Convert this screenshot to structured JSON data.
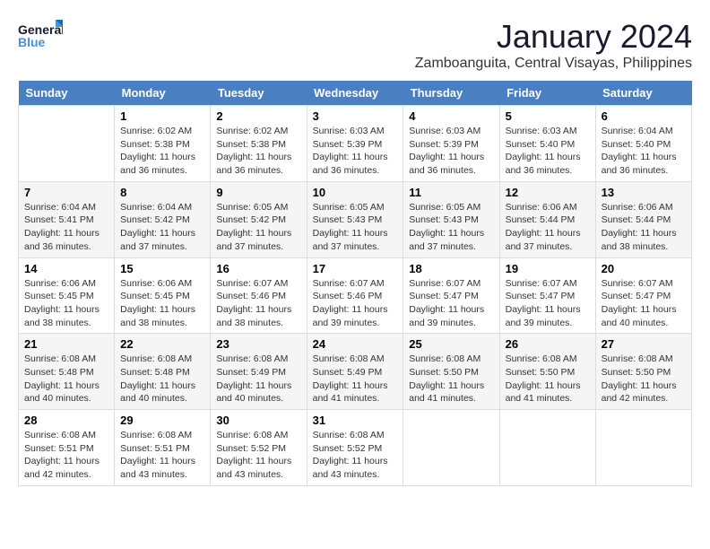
{
  "logo": {
    "general": "General",
    "blue": "Blue"
  },
  "title": {
    "month_year": "January 2024",
    "location": "Zamboanguita, Central Visayas, Philippines"
  },
  "headers": [
    "Sunday",
    "Monday",
    "Tuesday",
    "Wednesday",
    "Thursday",
    "Friday",
    "Saturday"
  ],
  "weeks": [
    [
      {
        "day": "",
        "sunrise": "",
        "sunset": "",
        "daylight": ""
      },
      {
        "day": "1",
        "sunrise": "Sunrise: 6:02 AM",
        "sunset": "Sunset: 5:38 PM",
        "daylight": "Daylight: 11 hours and 36 minutes."
      },
      {
        "day": "2",
        "sunrise": "Sunrise: 6:02 AM",
        "sunset": "Sunset: 5:38 PM",
        "daylight": "Daylight: 11 hours and 36 minutes."
      },
      {
        "day": "3",
        "sunrise": "Sunrise: 6:03 AM",
        "sunset": "Sunset: 5:39 PM",
        "daylight": "Daylight: 11 hours and 36 minutes."
      },
      {
        "day": "4",
        "sunrise": "Sunrise: 6:03 AM",
        "sunset": "Sunset: 5:39 PM",
        "daylight": "Daylight: 11 hours and 36 minutes."
      },
      {
        "day": "5",
        "sunrise": "Sunrise: 6:03 AM",
        "sunset": "Sunset: 5:40 PM",
        "daylight": "Daylight: 11 hours and 36 minutes."
      },
      {
        "day": "6",
        "sunrise": "Sunrise: 6:04 AM",
        "sunset": "Sunset: 5:40 PM",
        "daylight": "Daylight: 11 hours and 36 minutes."
      }
    ],
    [
      {
        "day": "7",
        "sunrise": "Sunrise: 6:04 AM",
        "sunset": "Sunset: 5:41 PM",
        "daylight": "Daylight: 11 hours and 36 minutes."
      },
      {
        "day": "8",
        "sunrise": "Sunrise: 6:04 AM",
        "sunset": "Sunset: 5:42 PM",
        "daylight": "Daylight: 11 hours and 37 minutes."
      },
      {
        "day": "9",
        "sunrise": "Sunrise: 6:05 AM",
        "sunset": "Sunset: 5:42 PM",
        "daylight": "Daylight: 11 hours and 37 minutes."
      },
      {
        "day": "10",
        "sunrise": "Sunrise: 6:05 AM",
        "sunset": "Sunset: 5:43 PM",
        "daylight": "Daylight: 11 hours and 37 minutes."
      },
      {
        "day": "11",
        "sunrise": "Sunrise: 6:05 AM",
        "sunset": "Sunset: 5:43 PM",
        "daylight": "Daylight: 11 hours and 37 minutes."
      },
      {
        "day": "12",
        "sunrise": "Sunrise: 6:06 AM",
        "sunset": "Sunset: 5:44 PM",
        "daylight": "Daylight: 11 hours and 37 minutes."
      },
      {
        "day": "13",
        "sunrise": "Sunrise: 6:06 AM",
        "sunset": "Sunset: 5:44 PM",
        "daylight": "Daylight: 11 hours and 38 minutes."
      }
    ],
    [
      {
        "day": "14",
        "sunrise": "Sunrise: 6:06 AM",
        "sunset": "Sunset: 5:45 PM",
        "daylight": "Daylight: 11 hours and 38 minutes."
      },
      {
        "day": "15",
        "sunrise": "Sunrise: 6:06 AM",
        "sunset": "Sunset: 5:45 PM",
        "daylight": "Daylight: 11 hours and 38 minutes."
      },
      {
        "day": "16",
        "sunrise": "Sunrise: 6:07 AM",
        "sunset": "Sunset: 5:46 PM",
        "daylight": "Daylight: 11 hours and 38 minutes."
      },
      {
        "day": "17",
        "sunrise": "Sunrise: 6:07 AM",
        "sunset": "Sunset: 5:46 PM",
        "daylight": "Daylight: 11 hours and 39 minutes."
      },
      {
        "day": "18",
        "sunrise": "Sunrise: 6:07 AM",
        "sunset": "Sunset: 5:47 PM",
        "daylight": "Daylight: 11 hours and 39 minutes."
      },
      {
        "day": "19",
        "sunrise": "Sunrise: 6:07 AM",
        "sunset": "Sunset: 5:47 PM",
        "daylight": "Daylight: 11 hours and 39 minutes."
      },
      {
        "day": "20",
        "sunrise": "Sunrise: 6:07 AM",
        "sunset": "Sunset: 5:47 PM",
        "daylight": "Daylight: 11 hours and 40 minutes."
      }
    ],
    [
      {
        "day": "21",
        "sunrise": "Sunrise: 6:08 AM",
        "sunset": "Sunset: 5:48 PM",
        "daylight": "Daylight: 11 hours and 40 minutes."
      },
      {
        "day": "22",
        "sunrise": "Sunrise: 6:08 AM",
        "sunset": "Sunset: 5:48 PM",
        "daylight": "Daylight: 11 hours and 40 minutes."
      },
      {
        "day": "23",
        "sunrise": "Sunrise: 6:08 AM",
        "sunset": "Sunset: 5:49 PM",
        "daylight": "Daylight: 11 hours and 40 minutes."
      },
      {
        "day": "24",
        "sunrise": "Sunrise: 6:08 AM",
        "sunset": "Sunset: 5:49 PM",
        "daylight": "Daylight: 11 hours and 41 minutes."
      },
      {
        "day": "25",
        "sunrise": "Sunrise: 6:08 AM",
        "sunset": "Sunset: 5:50 PM",
        "daylight": "Daylight: 11 hours and 41 minutes."
      },
      {
        "day": "26",
        "sunrise": "Sunrise: 6:08 AM",
        "sunset": "Sunset: 5:50 PM",
        "daylight": "Daylight: 11 hours and 41 minutes."
      },
      {
        "day": "27",
        "sunrise": "Sunrise: 6:08 AM",
        "sunset": "Sunset: 5:50 PM",
        "daylight": "Daylight: 11 hours and 42 minutes."
      }
    ],
    [
      {
        "day": "28",
        "sunrise": "Sunrise: 6:08 AM",
        "sunset": "Sunset: 5:51 PM",
        "daylight": "Daylight: 11 hours and 42 minutes."
      },
      {
        "day": "29",
        "sunrise": "Sunrise: 6:08 AM",
        "sunset": "Sunset: 5:51 PM",
        "daylight": "Daylight: 11 hours and 43 minutes."
      },
      {
        "day": "30",
        "sunrise": "Sunrise: 6:08 AM",
        "sunset": "Sunset: 5:52 PM",
        "daylight": "Daylight: 11 hours and 43 minutes."
      },
      {
        "day": "31",
        "sunrise": "Sunrise: 6:08 AM",
        "sunset": "Sunset: 5:52 PM",
        "daylight": "Daylight: 11 hours and 43 minutes."
      },
      {
        "day": "",
        "sunrise": "",
        "sunset": "",
        "daylight": ""
      },
      {
        "day": "",
        "sunrise": "",
        "sunset": "",
        "daylight": ""
      },
      {
        "day": "",
        "sunrise": "",
        "sunset": "",
        "daylight": ""
      }
    ]
  ]
}
